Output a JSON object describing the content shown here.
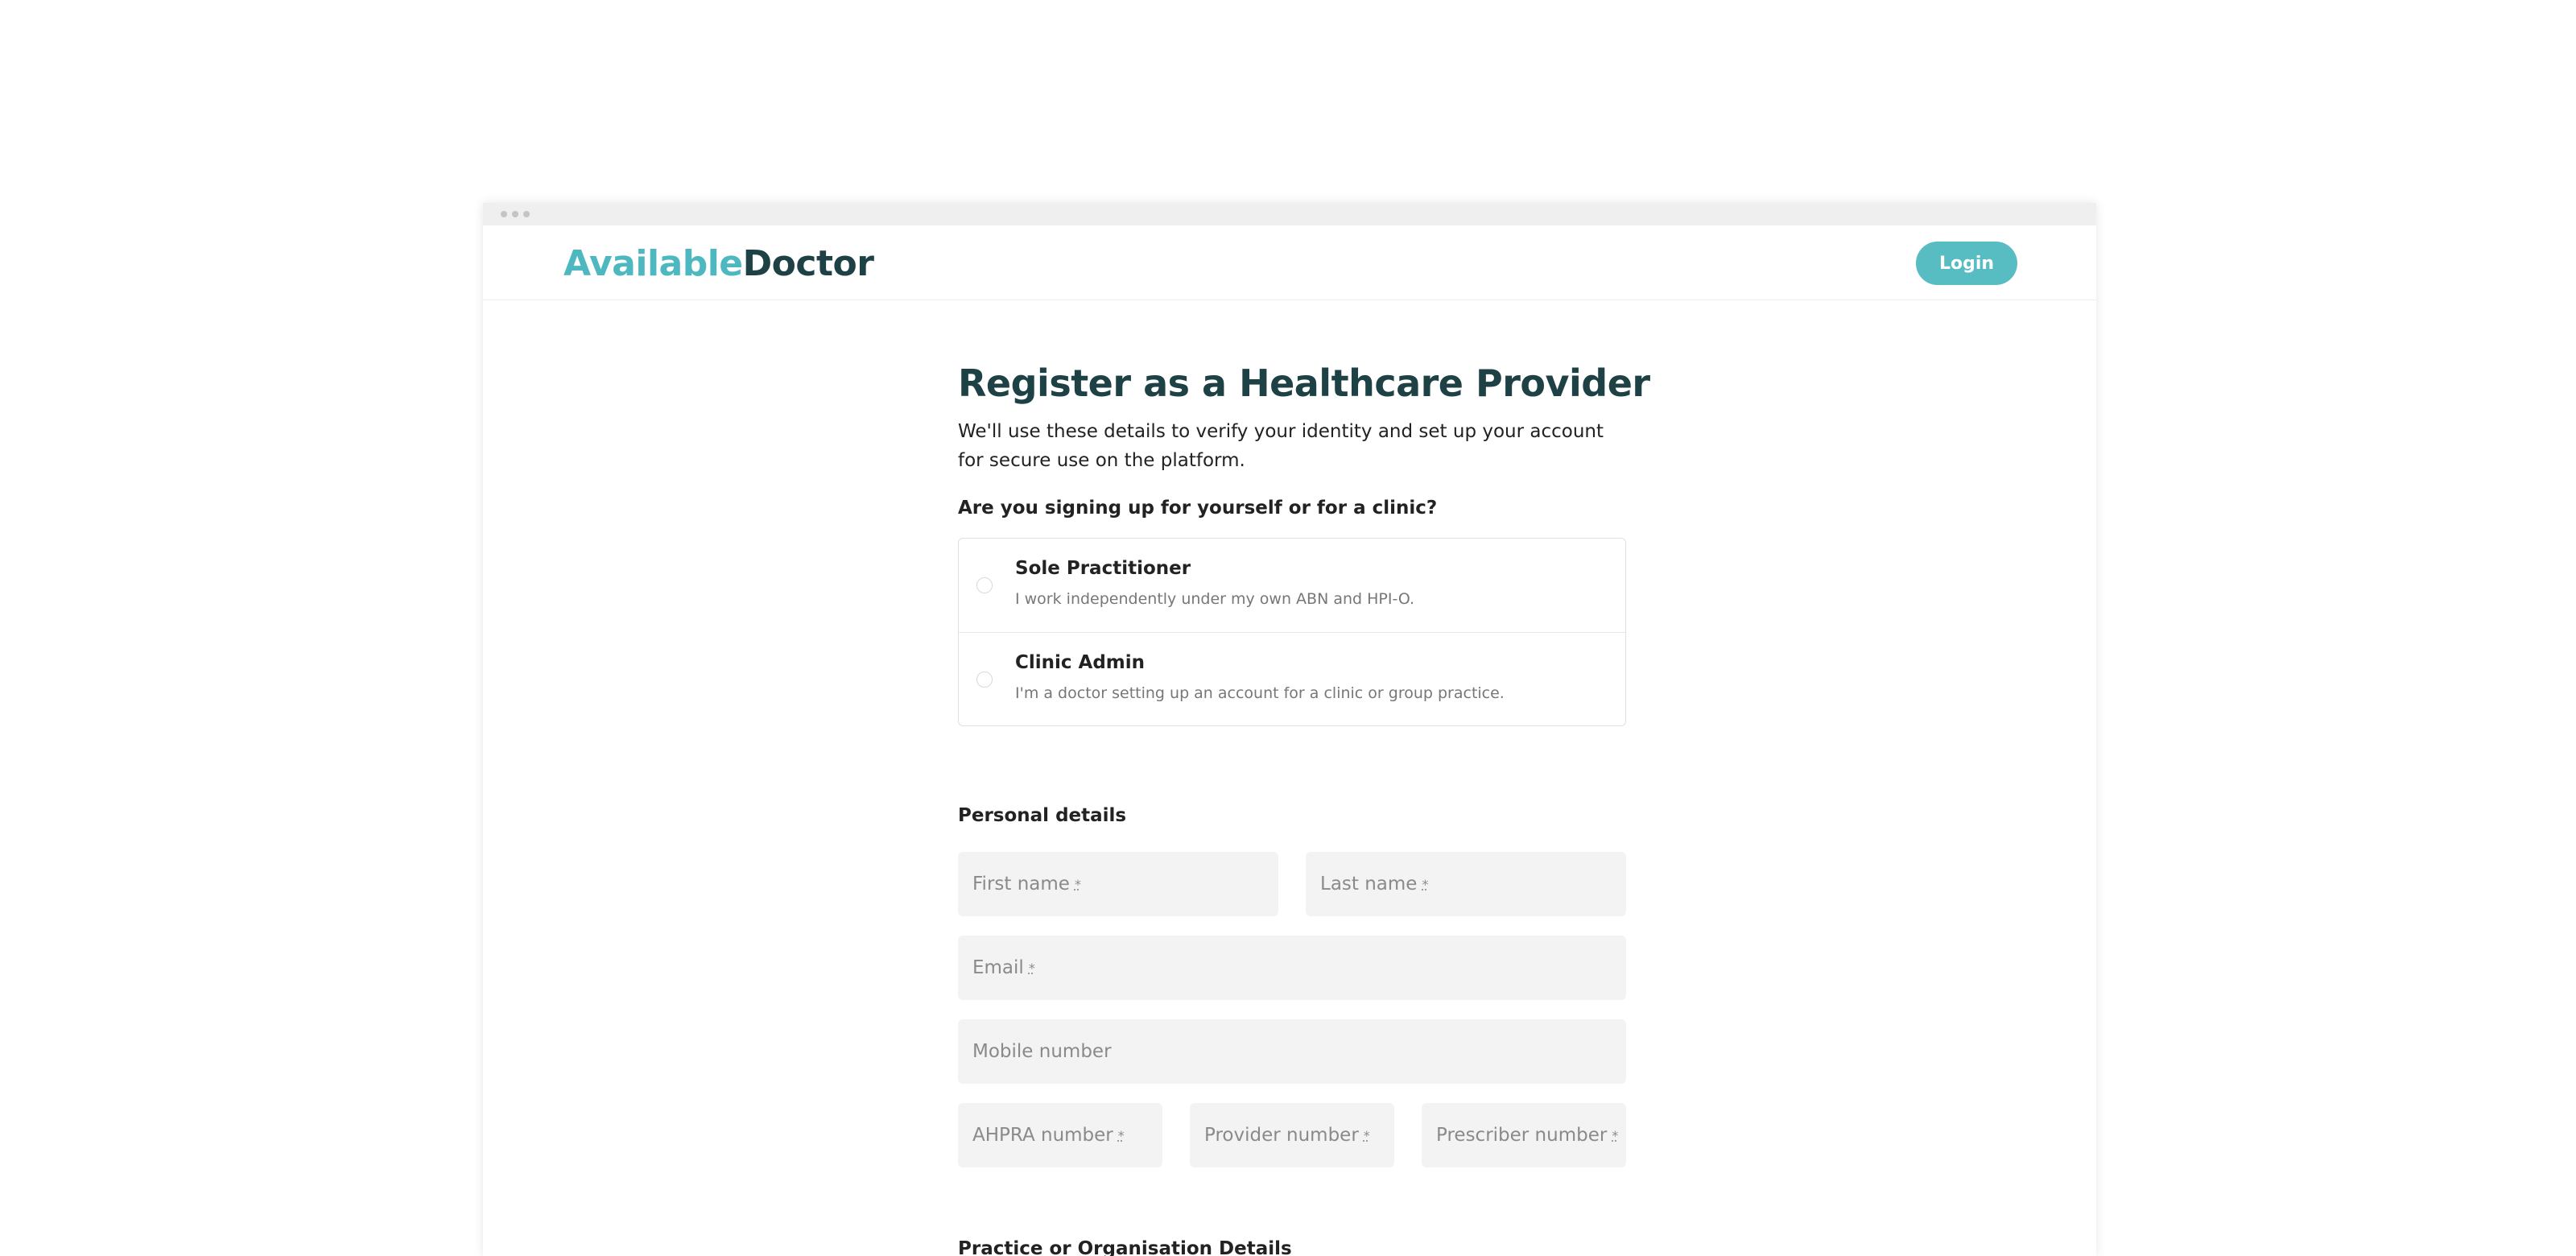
{
  "header": {
    "logo_part_a": "Available",
    "logo_part_b": "Doctor",
    "login_label": "Login"
  },
  "page": {
    "title": "Register as a Healthcare Provider",
    "subtitle": "We'll use these details to verify your identity and set up your account for secure use on the platform.",
    "question": "Are you signing up for yourself or for a clinic?"
  },
  "account_types": [
    {
      "title": "Sole Practitioner",
      "description": "I work independently under my own ABN and HPI-O."
    },
    {
      "title": "Clinic Admin",
      "description": "I'm a doctor setting up an account for a clinic or group practice."
    }
  ],
  "personal_details": {
    "heading": "Personal details",
    "first_name": "First name",
    "last_name": "Last name",
    "email": "Email",
    "mobile": "Mobile number",
    "ahpra": "AHPRA number",
    "provider": "Provider number",
    "prescriber": "Prescriber number",
    "required_mark": "*"
  },
  "practice": {
    "heading": "Practice or Organisation Details"
  },
  "colors": {
    "brand_teal": "#4db8c0",
    "brand_dark": "#1d4144",
    "button": "#58bcc3",
    "field_bg": "#f3f3f3"
  }
}
